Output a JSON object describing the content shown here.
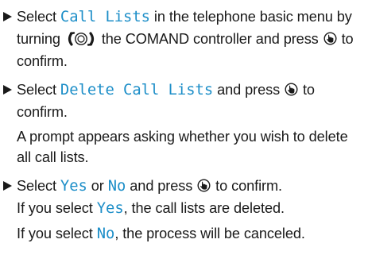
{
  "steps": [
    {
      "seg": [
        "Select ",
        "Call Lists",
        " in the telephone basic menu by turning ",
        " the COMAND controller and press ",
        " to confirm."
      ]
    },
    {
      "seg": [
        "Select ",
        "Delete Call Lists",
        " and press ",
        " to confirm."
      ],
      "note": "A prompt appears asking whether you wish to delete all call lists."
    },
    {
      "seg": [
        "Select ",
        "Yes",
        " or ",
        "No",
        " and press ",
        " to confirm.",
        "If you select ",
        "Yes",
        ", the call lists are deleted."
      ],
      "para_seg": [
        "If you select ",
        "No",
        ", the process will be canceled."
      ]
    }
  ],
  "icons": {
    "bullet": "triangle-right-icon",
    "turn": "controller-turn-icon",
    "press": "controller-press-icon"
  },
  "colors": {
    "highlight": "#1c8ec8",
    "text": "#1a1a1a"
  }
}
